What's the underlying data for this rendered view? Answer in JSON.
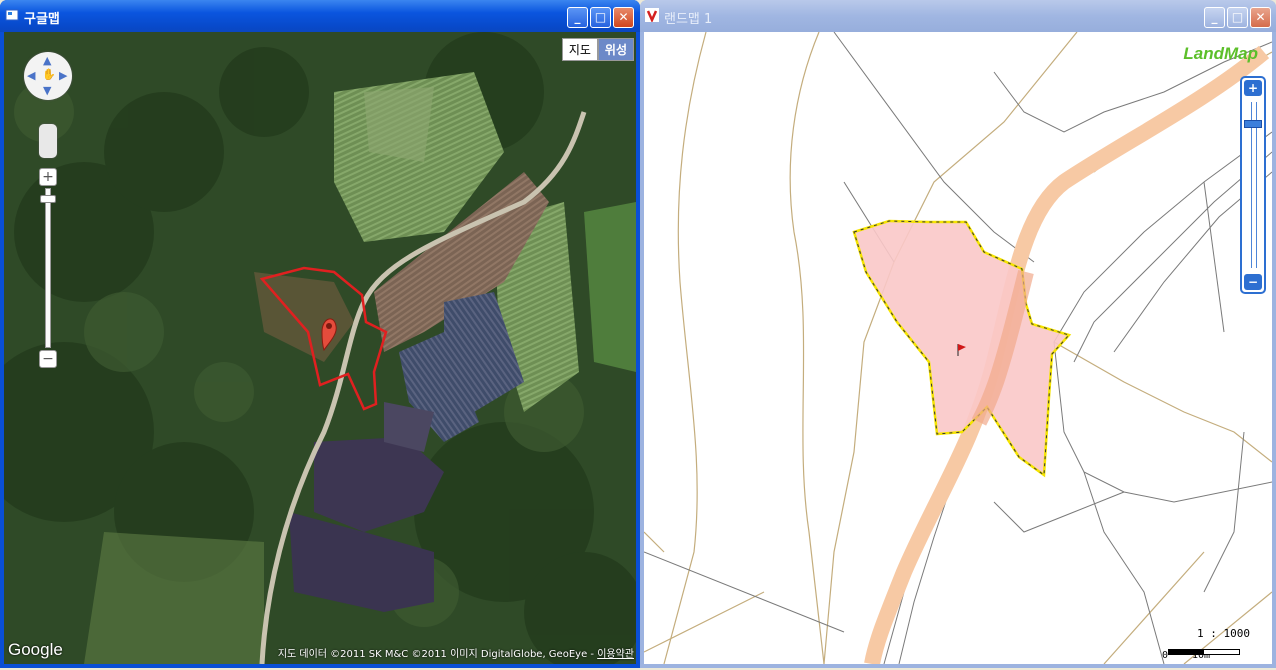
{
  "windows": {
    "google": {
      "title": "구글맵",
      "map_type_buttons": [
        "지도",
        "위성"
      ],
      "active_map_type": "위성",
      "logo": "Google",
      "attribution": "지도 데이터 ©2011 SK M&C ©2011 이미지 DigitalGlobe, GeoEye - ",
      "terms_link": "이용약관"
    },
    "landmap": {
      "title": "랜드맵 1",
      "logo": "LandMap",
      "scale_ratio": "1 : 1000",
      "scale_labels": [
        "0",
        "10m"
      ]
    }
  },
  "titlebar_buttons": {
    "minimize": "_",
    "maximize": "□",
    "close": "✕"
  },
  "colors": {
    "parcel_outline_google": "#e02020",
    "parcel_fill_landmap": "#f9c8c8",
    "parcel_border_landmap": "#f5e400",
    "road": "#f7c9a4",
    "marker": "#e54c3c"
  }
}
